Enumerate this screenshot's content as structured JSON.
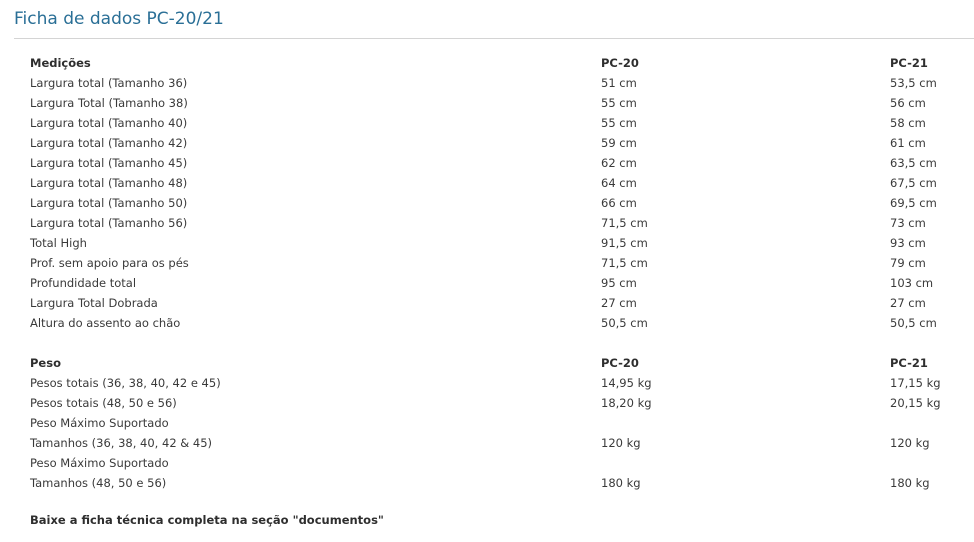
{
  "title": "Ficha de dados PC-20/21",
  "measurements": {
    "header": [
      "Medições",
      "PC-20",
      "PC-21"
    ],
    "rows": [
      [
        "Largura total (Tamanho 36)",
        "51 cm",
        "53,5 cm"
      ],
      [
        "Largura Total (Tamanho 38)",
        "55 cm",
        "56 cm"
      ],
      [
        "Largura total (Tamanho 40)",
        "55 cm",
        "58 cm"
      ],
      [
        "Largura total (Tamanho 42)",
        "59 cm",
        "61 cm"
      ],
      [
        "Largura total (Tamanho 45)",
        "62 cm",
        "63,5 cm"
      ],
      [
        "Largura total (Tamanho 48)",
        "64 cm",
        "67,5 cm"
      ],
      [
        "Largura total (Tamanho 50)",
        "66 cm",
        "69,5 cm"
      ],
      [
        "Largura total (Tamanho 56)",
        "71,5 cm",
        "73 cm"
      ],
      [
        "Total High",
        "91,5 cm",
        "93 cm"
      ],
      [
        "Prof. sem apoio para os pés",
        "71,5 cm",
        "79 cm"
      ],
      [
        "Profundidade total",
        "95 cm",
        "103 cm"
      ],
      [
        "Largura Total Dobrada",
        "27 cm",
        "27 cm"
      ],
      [
        "Altura do assento ao chão",
        "50,5 cm",
        "50,5 cm"
      ]
    ]
  },
  "weight": {
    "header": [
      "Peso",
      "PC-20",
      "PC-21"
    ],
    "rows": [
      [
        "Pesos totais (36, 38, 40, 42 e 45)",
        "14,95 kg",
        "17,15 kg"
      ],
      [
        "Pesos totais (48, 50 e 56)",
        "18,20 kg",
        "20,15 kg"
      ],
      [
        "Peso Máximo Suportado",
        "",
        ""
      ],
      [
        "Tamanhos (36, 38, 40, 42 & 45)",
        "120 kg",
        "120 kg"
      ],
      [
        "Peso Máximo Suportado",
        "",
        ""
      ],
      [
        "Tamanhos (48, 50 e 56)",
        "180 kg",
        "180 kg"
      ]
    ]
  },
  "footer_note": "Baixe a ficha técnica completa na seção \"documentos\"",
  "colors": {
    "title": "#2a6f96",
    "text": "#3a3a3a",
    "divider": "#d4d4d4"
  }
}
